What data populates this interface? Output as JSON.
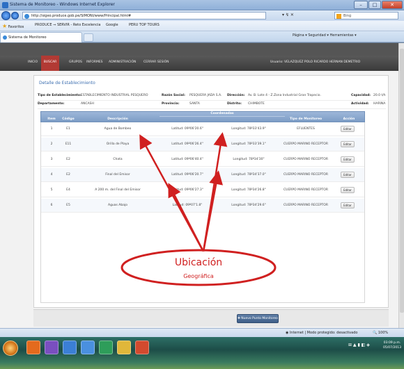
{
  "window": {
    "title": "Sistema de Monitoreo - Windows Internet Explorer",
    "minimize": "–",
    "maximize": "□",
    "close": "✕"
  },
  "address": {
    "url": "http://sigeo.produce.gob.pe/SIMONI/www/Principal.html#",
    "tools": "▾ ↯ ✕",
    "search": "Bing"
  },
  "favorites": {
    "label": "Favoritos",
    "items": [
      "PRODUCE ⇒ SERVIR - Reto Excelencia",
      "Google",
      "PERU TOP TOURS"
    ]
  },
  "tab": {
    "label": "Sistema de Monitoreo"
  },
  "commandbar": "Página ▾  Seguridad ▾  Herramientas ▾",
  "nav": {
    "items": [
      "INICIO",
      "BUSCAR",
      "GRUPOS",
      "INFORMES",
      "ADMINISTRACIÓN",
      "CERRAR SESIÓN"
    ],
    "active": "BUSCAR",
    "user": "Usuario: VELAZQUEZ POLO RICARDO HERNAN DEMETRIO"
  },
  "panel": {
    "title": "Detalle de Establecimiento",
    "tipo_label": "Tipo de Establecimiento:",
    "tipo_value": "ESTABLECIMIENTO INDUSTRIAL PESQUERO",
    "razon_label": "Razón Social:",
    "razon_value": "PESQUERA JADA S.A.",
    "direccion_label": "Dirección:",
    "direccion_value": "Av. B. Lote 4 - Z.Zona Industrial Gran Trapecio.",
    "capacidad_label": "Capacidad:",
    "capacidad_value": "20.0 t/h",
    "depto_label": "Departamento:",
    "depto_value": "ANCASH",
    "prov_label": "Provincia:",
    "prov_value": "SANTA",
    "distrito_label": "Distrito:",
    "distrito_value": "CHIMBOTE",
    "actividad_label": "Actividad:",
    "actividad_value": "HARINA"
  },
  "grid": {
    "coords_header": "Coordenadas",
    "headers": [
      "Item",
      "Código",
      "Descripción",
      "",
      "",
      "Tipo de Monitoreo",
      "Acción"
    ],
    "rows": [
      {
        "item": "1",
        "codigo": "E1",
        "desc": "Agua de Bombeo",
        "lat": "Latitud: 09º06'20.6\"",
        "lon": "Longitud: 78º33'43.9\"",
        "tipo": "EFLUENTES",
        "accion": "Editar"
      },
      {
        "item": "2",
        "codigo": "E11",
        "desc": "Orilla de Playa",
        "lat": "Latitud: 09º06'26.4\"",
        "lon": "Longitud: 78º33'39.1\"",
        "tipo": "CUERPO MARINO RECEPTOR",
        "accion": "Editar"
      },
      {
        "item": "3",
        "codigo": "E2",
        "desc": "Chata",
        "lat": "Latitud: 09º06'40.4\"",
        "lon": "Longitud: 78º34'30\"",
        "tipo": "CUERPO MARINO RECEPTOR",
        "accion": "Editar"
      },
      {
        "item": "4",
        "codigo": "E2",
        "desc": "Final del Emisor",
        "lat": "Latitud: 09º06'20.7\"",
        "lon": "Longitud: 78º34'37.0\"",
        "tipo": "CUERPO MARINO RECEPTOR",
        "accion": "Editar"
      },
      {
        "item": "5",
        "codigo": "E4",
        "desc": "A 200 m. del Final del Emisor",
        "lat": "Latitud: 09º06'27.3\"",
        "lon": "Longitud: 78º34'26.8\"",
        "tipo": "CUERPO MARINO RECEPTOR",
        "accion": "Editar"
      },
      {
        "item": "6",
        "codigo": "E5",
        "desc": "Aguas Abajo",
        "lat": "Latitud: 09º07'1.8\"",
        "lon": "Longitud: 78º34'29.6\"",
        "tipo": "CUERPO MARINO RECEPTOR",
        "accion": "Editar"
      }
    ],
    "new_point": "Nuevo Punto Monitoreo"
  },
  "status": {
    "zone": "Internet | Modo protegido: desactivado",
    "zoom": "100%"
  },
  "tray": {
    "time": "03:09 p.m.",
    "date": "05/07/2013"
  },
  "annotation": {
    "title": "Ubicación",
    "subtitle": "Geográfica",
    "color": "#d02020"
  }
}
